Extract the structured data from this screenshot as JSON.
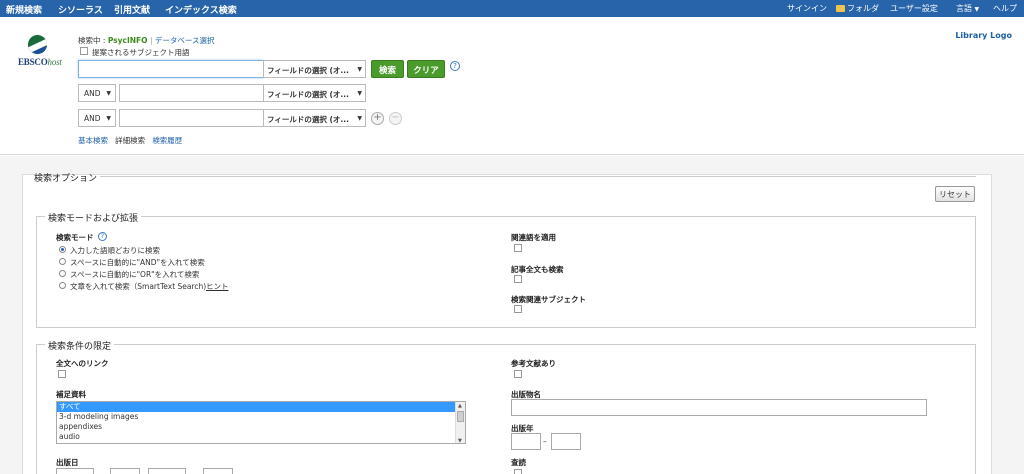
{
  "topnav": {
    "items": [
      "新規検索",
      "シソーラス",
      "引用文献",
      "インデックス検索"
    ],
    "right": {
      "signin": "サインイン",
      "folder": "フォルダ",
      "preferences": "ユーザー設定",
      "language": "言語",
      "language_caret": "▼",
      "help": "ヘルプ"
    }
  },
  "logo": {
    "ebsco": "EBSCO",
    "host": "host"
  },
  "library_logo": "Library Logo",
  "search": {
    "searching_label": "検索中 :",
    "database": "PsycINFO",
    "separator": "|",
    "choose_db": "データベース選択",
    "suggest_subject": "提案されるサブジェクト用語",
    "field_select": "フィールドの選択 (オ...",
    "search_button": "検索",
    "clear_button": "クリア",
    "help": "?",
    "operators": [
      "AND",
      "AND"
    ],
    "add": "+",
    "remove": "−",
    "links": {
      "basic": "基本検索",
      "advanced": "詳細検索",
      "history": "検索履歴"
    }
  },
  "options": {
    "title": "検索オプション",
    "reset": "リセット",
    "modes": {
      "title": "検索モードおよび拡張",
      "mode_label": "検索モード",
      "mode_help": "?",
      "radios": [
        "入力した語順どおりに検索",
        "スペースに自動的に\"AND\"を入れて検索",
        "スペースに自動的に\"OR\"を入れて検索",
        "文章を入れて検索（SmartText Search)"
      ],
      "hint": "ヒント",
      "selected_radio": 0,
      "related_words": "関連語を適用",
      "fulltext_search": "記事全文も検索",
      "related_subjects": "検索関連サブジェクト"
    },
    "limits": {
      "title": "検索条件の限定",
      "fulltext_link": "全文へのリンク",
      "references": "参考文献あり",
      "supplemental": "補足資料",
      "supplemental_options": [
        "すべて",
        "3-d modeling images",
        "appendixes",
        "audio"
      ],
      "publication": "出版物名",
      "pub_year": "出版年",
      "range_dash": "–",
      "pub_date": "出版日",
      "peer_reviewed": "査読"
    }
  }
}
